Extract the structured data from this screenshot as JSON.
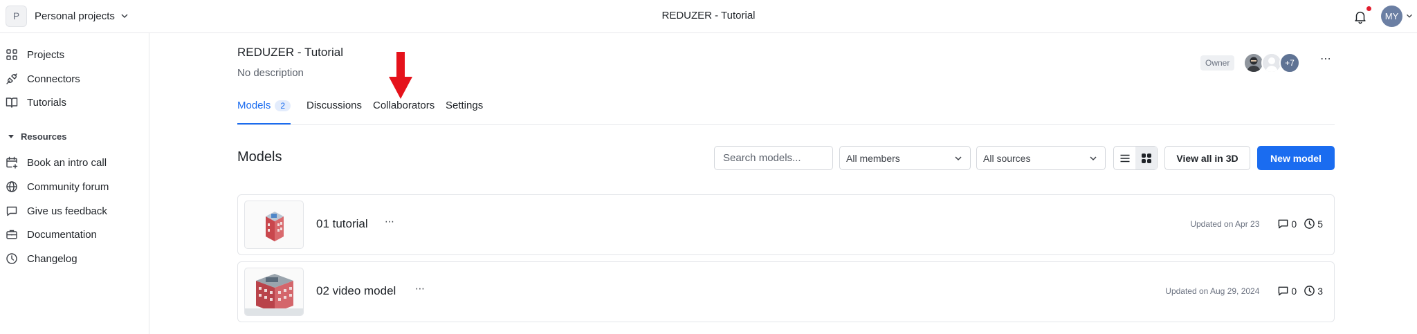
{
  "topbar": {
    "workspace_initial": "P",
    "workspace_name": "Personal projects",
    "title": "REDUZER - Tutorial",
    "user_initials": "MY"
  },
  "sidebar": {
    "items": [
      {
        "label": "Projects",
        "icon": "grid-icon"
      },
      {
        "label": "Connectors",
        "icon": "plug-icon"
      },
      {
        "label": "Tutorials",
        "icon": "book-icon"
      }
    ],
    "section_label": "Resources",
    "resources": [
      {
        "label": "Book an intro call",
        "icon": "calendar-plus-icon"
      },
      {
        "label": "Community forum",
        "icon": "globe-icon"
      },
      {
        "label": "Give us feedback",
        "icon": "chat-icon"
      },
      {
        "label": "Documentation",
        "icon": "briefcase-icon"
      },
      {
        "label": "Changelog",
        "icon": "clock-icon"
      }
    ]
  },
  "project": {
    "title": "REDUZER - Tutorial",
    "description": "No description",
    "role_badge": "Owner",
    "extra_collaborators": "+7"
  },
  "tabs": [
    {
      "label": "Models",
      "count": "2"
    },
    {
      "label": "Discussions"
    },
    {
      "label": "Collaborators"
    },
    {
      "label": "Settings"
    }
  ],
  "models_section": {
    "heading": "Models",
    "search_placeholder": "Search models...",
    "members_select": "All members",
    "sources_select": "All sources",
    "view_all_3d": "View all in 3D",
    "new_model": "New model"
  },
  "models": [
    {
      "name": "01 tutorial",
      "updated": "Updated on Apr 23",
      "comments": "0",
      "versions": "5"
    },
    {
      "name": "02 video model",
      "updated": "Updated on Aug 29, 2024",
      "comments": "0",
      "versions": "3"
    }
  ],
  "annotation": {
    "arrow_color": "#e5121b"
  }
}
